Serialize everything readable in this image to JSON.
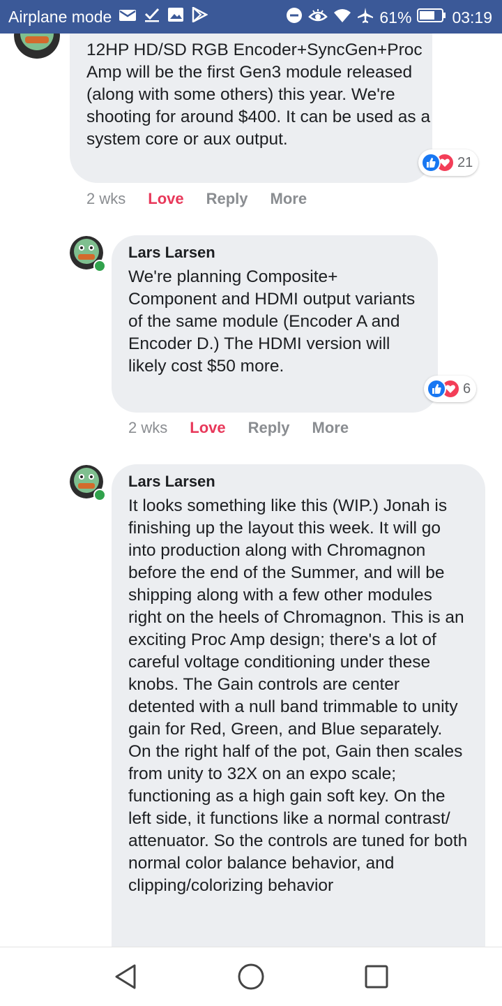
{
  "status_bar": {
    "mode_label": "Airplane mode",
    "battery": "61%",
    "time": "03:19"
  },
  "comments": [
    {
      "author": "",
      "text": "12HP HD/SD RGB Encoder+SyncGen+Proc Amp will be the first Gen3 module released (along with some others) this year. We're shooting for around $400. It can be used as a system core or aux output.",
      "reaction_count": "21",
      "time": "2 wks",
      "love_label": "Love",
      "reply_label": "Reply",
      "more_label": "More"
    },
    {
      "author": "Lars Larsen",
      "text": "We're planning Composite+ Component and HDMI output variants of the same module (Encoder A and Encoder D.) The HDMI version will likely cost $50 more.",
      "reaction_count": "6",
      "time": "2 wks",
      "love_label": "Love",
      "reply_label": "Reply",
      "more_label": "More"
    },
    {
      "author": "Lars Larsen",
      "text": "It looks something like this (WIP.) Jonah is finishing up the layout this week. It will go into production along with Chromagnon before the end of the Summer, and will be shipping along with a few other modules right on the heels of Chromagnon. This is an exciting Proc Amp design; there's a lot of careful voltage conditioning under these knobs. The Gain controls are center detented with a null band trimmable to unity gain for Red, Green, and Blue separately. On the right half of the pot, Gain then scales from unity to 32X on an expo scale; functioning as a high gain soft key. On the left side, it functions like a normal contrast/ attenuator. So the controls are tuned for both normal color balance behavior, and clipping/colorizing behavior"
    }
  ],
  "icons": [
    "mail-icon",
    "check-icon",
    "image-icon",
    "play-store-icon",
    "dnd-icon",
    "eye-icon",
    "wifi-icon",
    "airplane-icon",
    "battery-icon",
    "back-icon",
    "home-icon",
    "recents-icon",
    "like-icon",
    "heart-icon"
  ],
  "colors": {
    "status_bar": "#3b5998",
    "bubble": "#eceef1",
    "love": "#e8385a",
    "online": "#31a24c",
    "like": "#1877f2",
    "heart": "#f33e58"
  }
}
